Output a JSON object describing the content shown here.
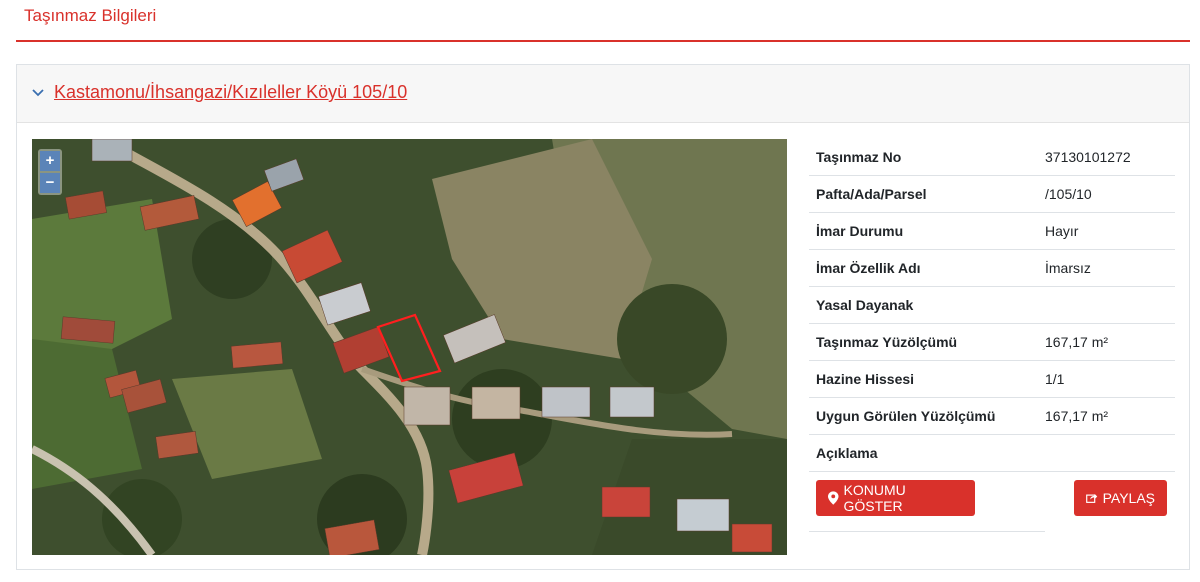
{
  "page": {
    "title": "Taşınmaz Bilgileri"
  },
  "property": {
    "header_link": "Kastamonu/İhsangazi/Kızıleller Köyü 105/10",
    "rows": [
      {
        "label": "Taşınmaz No",
        "value": "37130101272"
      },
      {
        "label": "Pafta/Ada/Parsel",
        "value": "/105/10"
      },
      {
        "label": "İmar Durumu",
        "value": "Hayır"
      },
      {
        "label": "İmar Özellik Adı",
        "value": "İmarsız"
      },
      {
        "label": "Yasal Dayanak",
        "value": ""
      },
      {
        "label": "Taşınmaz Yüzölçümü",
        "value": "167,17 m²"
      },
      {
        "label": "Hazine Hissesi",
        "value": "1/1"
      },
      {
        "label": "Uygun Görülen Yüzölçümü",
        "value": "167,17 m²"
      },
      {
        "label": "Açıklama",
        "value": ""
      }
    ]
  },
  "map": {
    "zoom_in": "+",
    "zoom_out": "−"
  },
  "actions": {
    "location_label": "KONUMU GÖSTER",
    "share_label": "PAYLAŞ"
  },
  "colors": {
    "accent": "#d9312b",
    "zoom": "#5b84b8"
  }
}
